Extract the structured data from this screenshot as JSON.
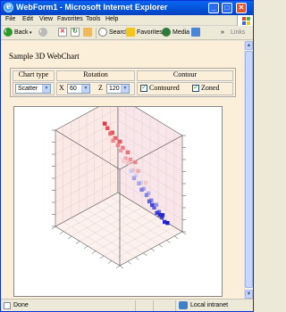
{
  "window": {
    "title": "WebForm1 - Microsoft Internet Explorer",
    "minimize": "_",
    "maximize": "□",
    "close": "✕"
  },
  "menu": [
    "File",
    "Edit",
    "View",
    "Favorites",
    "Tools",
    "Help"
  ],
  "toolbar": {
    "back": "Back",
    "search": "Search",
    "favorites": "Favorites",
    "media": "Media",
    "chevron": "»",
    "links": "Links"
  },
  "page": {
    "heading": "Sample 3D WebChart",
    "controls": {
      "chart_type_header": "Chart type",
      "rotation_header": "Rotation",
      "contour_header": "Contour",
      "chart_type_value": "Scatter",
      "x_label": "X",
      "x_value": "60",
      "z_label": "Z",
      "z_value": "120",
      "contoured_label": "Contoured",
      "contoured_checked": true,
      "zoned_label": "Zoned",
      "zoned_checked": true
    }
  },
  "chart_data": {
    "type": "scatter",
    "subtype": "3d",
    "axes": [
      "x",
      "y",
      "z"
    ],
    "xlim": [
      -4,
      4
    ],
    "ylim": [
      -4,
      4
    ],
    "zlim": [
      0,
      100
    ],
    "color_scale": {
      "high": "#e8232d",
      "low": "#1414d0"
    },
    "points": [
      {
        "x": -3,
        "y": 3,
        "z": 95
      },
      {
        "x": -2,
        "y": 3,
        "z": 90
      },
      {
        "x": -1,
        "y": 3,
        "z": 85
      },
      {
        "x": 0,
        "y": 3,
        "z": 78
      },
      {
        "x": 1,
        "y": 3,
        "z": 72
      },
      {
        "x": -3,
        "y": 2,
        "z": 88
      },
      {
        "x": -2,
        "y": 2,
        "z": 82
      },
      {
        "x": -1,
        "y": 2,
        "z": 76
      },
      {
        "x": 0,
        "y": 2,
        "z": 68
      },
      {
        "x": 1,
        "y": 2,
        "z": 60
      },
      {
        "x": 2,
        "y": 2,
        "z": 52
      },
      {
        "x": -3,
        "y": 1,
        "z": 80
      },
      {
        "x": -2,
        "y": 1,
        "z": 72
      },
      {
        "x": -1,
        "y": 1,
        "z": 62
      },
      {
        "x": 0,
        "y": 1,
        "z": 54
      },
      {
        "x": 1,
        "y": 1,
        "z": 45
      },
      {
        "x": 2,
        "y": 1,
        "z": 38
      },
      {
        "x": -2,
        "y": 0,
        "z": 64
      },
      {
        "x": -1,
        "y": 0,
        "z": 55
      },
      {
        "x": 0,
        "y": 0,
        "z": 46
      },
      {
        "x": 1,
        "y": 0,
        "z": 36
      },
      {
        "x": 2,
        "y": 0,
        "z": 28
      },
      {
        "x": 3,
        "y": 0,
        "z": 20
      },
      {
        "x": -1,
        "y": -1,
        "z": 44
      },
      {
        "x": 0,
        "y": -1,
        "z": 35
      },
      {
        "x": 1,
        "y": -1,
        "z": 27
      },
      {
        "x": 2,
        "y": -1,
        "z": 18
      },
      {
        "x": 3,
        "y": -1,
        "z": 12
      },
      {
        "x": 0,
        "y": -2,
        "z": 26
      },
      {
        "x": 1,
        "y": -2,
        "z": 18
      },
      {
        "x": 2,
        "y": -2,
        "z": 10
      },
      {
        "x": 3,
        "y": -2,
        "z": 5
      },
      {
        "x": 1,
        "y": -3,
        "z": 12
      },
      {
        "x": 2,
        "y": -3,
        "z": 6
      },
      {
        "x": 3,
        "y": -3,
        "z": 2
      },
      {
        "x": -3,
        "y": 0,
        "z": 70
      },
      {
        "x": 3,
        "y": 1,
        "z": 30
      },
      {
        "x": 2,
        "y": -4,
        "z": 4
      },
      {
        "x": -2,
        "y": -1,
        "z": 50
      },
      {
        "x": -1,
        "y": -2,
        "z": 34
      }
    ]
  },
  "status": {
    "text": "Done",
    "zone": "Local intranet"
  }
}
